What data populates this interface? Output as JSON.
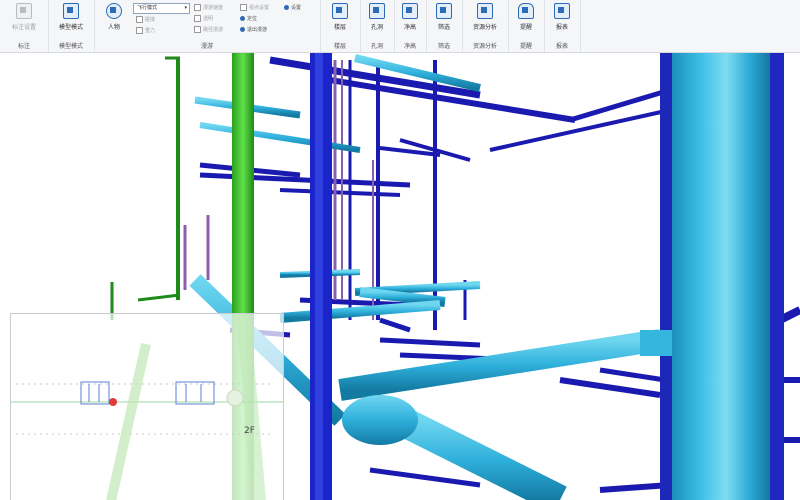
{
  "ribbon": {
    "groups": [
      {
        "label": "标注",
        "buttons": [
          {
            "label": "标注设置",
            "disabled": true
          }
        ]
      },
      {
        "label": "模型模式",
        "buttons": [
          {
            "label": "模型模式",
            "disabled": false
          }
        ]
      },
      {
        "label": "漫游",
        "buttons": [
          {
            "label": "人物",
            "disabled": false
          }
        ]
      },
      {
        "label": "楼层",
        "buttons": [
          {
            "label": "楼层",
            "disabled": false
          }
        ]
      },
      {
        "label": "孔洞",
        "buttons": [
          {
            "label": "孔洞",
            "disabled": false
          }
        ]
      },
      {
        "label": "净高",
        "buttons": [
          {
            "label": "净高",
            "disabled": false
          }
        ]
      },
      {
        "label": "筛选",
        "buttons": [
          {
            "label": "筛选",
            "disabled": false
          }
        ]
      },
      {
        "label": "资源分析",
        "buttons": [
          {
            "label": "资源分析",
            "disabled": false
          }
        ]
      },
      {
        "label": "提醒",
        "buttons": [
          {
            "label": "提醒",
            "disabled": false
          }
        ]
      },
      {
        "label": "报表",
        "buttons": [
          {
            "label": "报表",
            "disabled": false
          }
        ]
      }
    ],
    "walk_select": "飞行模式",
    "walk_options": [
      {
        "label": "碰撞",
        "disabled": true
      },
      {
        "label": "重力",
        "disabled": true
      }
    ],
    "walk_options2": [
      {
        "label": "漫游速度",
        "disabled": true
      },
      {
        "label": "透明",
        "disabled": true
      },
      {
        "label": "路径漫游",
        "disabled": true
      }
    ],
    "walk_options3": [
      {
        "label": "视点设置",
        "disabled": true
      },
      {
        "label": "定位"
      },
      {
        "label": "退出漫游"
      }
    ],
    "settings": "设置"
  },
  "viewport": {
    "floor_label": "2F"
  }
}
